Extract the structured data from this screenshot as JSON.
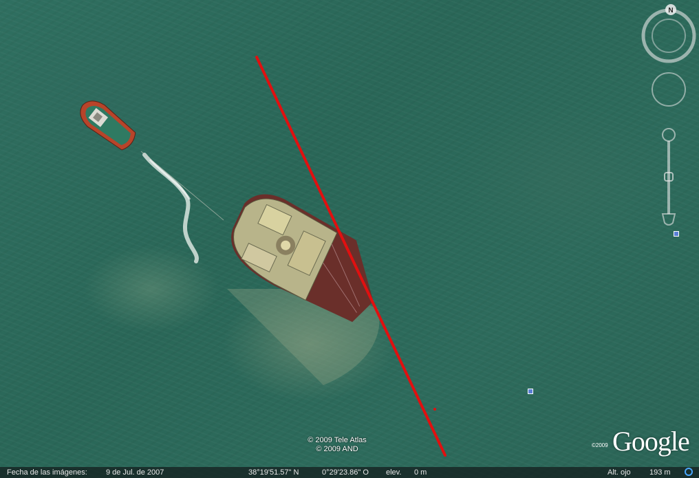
{
  "navigation": {
    "compass_label": "N"
  },
  "map": {
    "copyright_lines": [
      "© 2009 Tele Atlas",
      "© 2009 AND"
    ],
    "logo_year": "©2009",
    "logo_text": "Google",
    "measure_line_color": "#e01010"
  },
  "status_bar": {
    "imagery_date_label": "Fecha de las imágenes:",
    "imagery_date_value": "9 de Jul. de 2007",
    "latitude": "38°19'51.57\" N",
    "longitude": "0°29'23.86\" O",
    "elevation_label": "elev.",
    "elevation_value": "0 m",
    "eye_alt_label": "Alt. ojo",
    "eye_alt_value": "193 m"
  }
}
